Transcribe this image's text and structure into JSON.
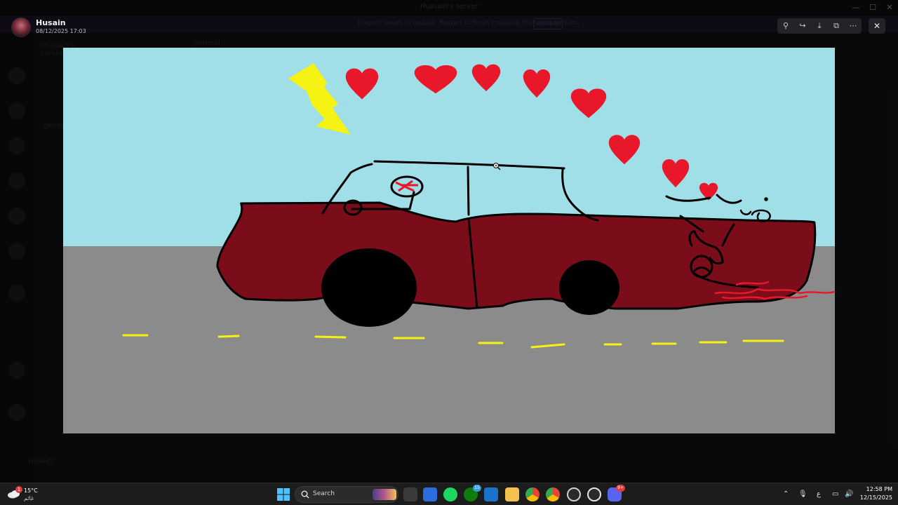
{
  "app": {
    "window_title": "Hussain's server",
    "banner_text": "Discord needs to update. Restart to finish installing the latest version.",
    "banner_button": "Update",
    "ghost_server": "Hussain's server",
    "ghost_channel": "general",
    "ghost_user": "Husain"
  },
  "viewer": {
    "sender_name": "Husain",
    "timestamp": "08/12/2025 17:03",
    "tools": [
      {
        "name": "zoom-icon",
        "glyph": "⚲"
      },
      {
        "name": "forward-icon",
        "glyph": "↪"
      },
      {
        "name": "download-icon",
        "glyph": "⤓"
      },
      {
        "name": "open-external-icon",
        "glyph": "⧉"
      },
      {
        "name": "more-icon",
        "glyph": "⋯"
      }
    ],
    "close_glyph": "✕"
  },
  "drawing": {
    "subject": "car-crash-doodle",
    "colors": {
      "sky": "#a0dfe8",
      "road": "#8b8b8b",
      "car": "#7b0d1b",
      "hearts": "#e8172a",
      "lightning": "#f5f214",
      "lane": "#f5f214",
      "blood": "#e8172a"
    },
    "hearts_count": 9,
    "handwriting": "فو"
  },
  "taskbar": {
    "weather_temp": "15°C",
    "weather_desc": "غائم",
    "weather_badge": "1",
    "search_label": "Search",
    "xbox_badge": "15",
    "discord_badge": "9+",
    "keyboard_lang": "ع",
    "time": "12:58 PM",
    "date": "12/15/2025"
  }
}
